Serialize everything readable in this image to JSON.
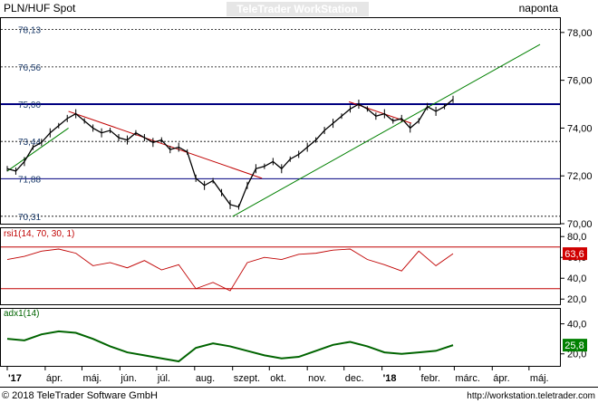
{
  "header": {
    "symbol": "PLN/HUF Spot",
    "watermark": "TeleTrader WorkStation",
    "interval": "naponta"
  },
  "footer": {
    "copyright": "© 2018 TeleTrader Software GmbH",
    "url": "http://workstation.teletrader.com"
  },
  "colors": {
    "price": "#000000",
    "trend_up": "#008000",
    "trend_down": "#c00000",
    "level_line": "#000080",
    "rsi": "#c00000",
    "rsi_badge": "#d00000",
    "adx": "#006400",
    "adx_badge": "#008000",
    "border": "#000000",
    "dashed": "#000000"
  },
  "chart_data": [
    {
      "type": "line",
      "panel": "price",
      "title": "PLN/HUF Spot",
      "x_ticks": [
        "'17",
        "ápr.",
        "máj.",
        "jún.",
        "júl.",
        "aug.",
        "szept.",
        "okt.",
        "nov.",
        "dec.",
        "'18",
        "febr.",
        "márc.",
        "ápr.",
        "máj."
      ],
      "ylim": [
        70.0,
        78.6
      ],
      "y_ticks": [
        "70,00",
        "72,00",
        "74,00",
        "76,00",
        "78,00"
      ],
      "series": [
        {
          "x": [
            "2017-03-01",
            "2017-03-08",
            "2017-03-15",
            "2017-03-22",
            "2017-03-29",
            "2017-04-05",
            "2017-04-12",
            "2017-04-19",
            "2017-04-26",
            "2017-05-03",
            "2017-05-10",
            "2017-05-17",
            "2017-05-24",
            "2017-05-31",
            "2017-06-07",
            "2017-06-14",
            "2017-06-21",
            "2017-06-28",
            "2017-07-05",
            "2017-07-12",
            "2017-07-19",
            "2017-07-26",
            "2017-08-02",
            "2017-08-09",
            "2017-08-16",
            "2017-08-23",
            "2017-08-30",
            "2017-09-06",
            "2017-09-13",
            "2017-09-20",
            "2017-09-27",
            "2017-10-04",
            "2017-10-11",
            "2017-10-18",
            "2017-10-25",
            "2017-11-01",
            "2017-11-08",
            "2017-11-15",
            "2017-11-22",
            "2017-11-29",
            "2017-12-06",
            "2017-12-13",
            "2017-12-20",
            "2017-12-27",
            "2018-01-03",
            "2018-01-10",
            "2018-01-17",
            "2018-01-24",
            "2018-01-31",
            "2018-02-07",
            "2018-02-14",
            "2018-02-21",
            "2018-02-28"
          ],
          "values": [
            72.3,
            72.2,
            72.6,
            73.2,
            73.4,
            73.8,
            74.1,
            74.4,
            74.6,
            74.3,
            74.0,
            73.8,
            73.9,
            73.6,
            73.5,
            73.8,
            73.6,
            73.4,
            73.5,
            73.1,
            73.2,
            73.0,
            71.9,
            71.6,
            71.8,
            71.3,
            70.8,
            70.7,
            71.6,
            72.3,
            72.4,
            72.6,
            72.3,
            72.7,
            72.9,
            73.2,
            73.5,
            73.9,
            74.2,
            74.5,
            74.8,
            75.0,
            74.8,
            74.5,
            74.6,
            74.3,
            74.4,
            74.0,
            74.3,
            74.9,
            74.7,
            74.9,
            75.2
          ]
        }
      ],
      "reference_lines": [
        {
          "value": 78.13,
          "label": "78,13",
          "style": "dashed"
        },
        {
          "value": 76.56,
          "label": "76,56",
          "style": "dashed"
        },
        {
          "value": 75.0,
          "label": "75,00",
          "style": "solid-thick"
        },
        {
          "value": 73.44,
          "label": "73,44",
          "style": "dashed"
        },
        {
          "value": 71.88,
          "label": "71,88",
          "style": "solid"
        },
        {
          "value": 70.31,
          "label": "70,31",
          "style": "dashed"
        }
      ],
      "trendlines": [
        {
          "kind": "up",
          "from": [
            "2017-03-01",
            72.2
          ],
          "to": [
            "2017-04-20",
            74.0
          ]
        },
        {
          "kind": "down",
          "from": [
            "2017-04-20",
            74.7
          ],
          "to": [
            "2017-09-25",
            71.9
          ]
        },
        {
          "kind": "up",
          "from": [
            "2017-09-01",
            70.3
          ],
          "to": [
            "2018-05-10",
            77.5
          ]
        },
        {
          "kind": "down",
          "from": [
            "2017-12-05",
            75.1
          ],
          "to": [
            "2018-01-25",
            74.2
          ]
        }
      ]
    },
    {
      "type": "line",
      "panel": "rsi",
      "title": "rsi1(14, 70, 30, 1)",
      "ylim": [
        15,
        88
      ],
      "y_ticks": [
        "20,0",
        "40,0",
        "60,0",
        "80,0"
      ],
      "levels": [
        70,
        30
      ],
      "last_value": "63,6",
      "series": [
        {
          "x": [
            "2017-03-01",
            "2017-03-15",
            "2017-03-29",
            "2017-04-12",
            "2017-04-26",
            "2017-05-10",
            "2017-05-24",
            "2017-06-07",
            "2017-06-21",
            "2017-07-05",
            "2017-07-19",
            "2017-08-02",
            "2017-08-16",
            "2017-08-30",
            "2017-09-13",
            "2017-09-27",
            "2017-10-11",
            "2017-10-25",
            "2017-11-08",
            "2017-11-22",
            "2017-12-06",
            "2017-12-20",
            "2018-01-03",
            "2018-01-17",
            "2018-01-31",
            "2018-02-14",
            "2018-02-28"
          ],
          "values": [
            58,
            61,
            66,
            68,
            64,
            52,
            55,
            50,
            57,
            48,
            53,
            30,
            36,
            28,
            55,
            60,
            58,
            63,
            64,
            67,
            68,
            58,
            53,
            47,
            66,
            52,
            63.6
          ]
        }
      ]
    },
    {
      "type": "line",
      "panel": "adx",
      "title": "adx1(14)",
      "ylim": [
        12,
        50
      ],
      "y_ticks": [
        "20,0",
        "40,0"
      ],
      "last_value": "25,8",
      "series": [
        {
          "x": [
            "2017-03-01",
            "2017-03-15",
            "2017-03-29",
            "2017-04-12",
            "2017-04-26",
            "2017-05-10",
            "2017-05-24",
            "2017-06-07",
            "2017-06-21",
            "2017-07-05",
            "2017-07-19",
            "2017-08-02",
            "2017-08-16",
            "2017-08-30",
            "2017-09-13",
            "2017-09-27",
            "2017-10-11",
            "2017-10-25",
            "2017-11-08",
            "2017-11-22",
            "2017-12-06",
            "2017-12-20",
            "2018-01-03",
            "2018-01-17",
            "2018-01-31",
            "2018-02-14",
            "2018-02-28"
          ],
          "values": [
            30,
            29,
            33,
            35,
            34,
            30,
            25,
            21,
            19,
            17,
            15,
            24,
            27,
            25,
            22,
            19,
            17,
            18,
            22,
            26,
            28,
            25,
            21,
            20,
            21,
            22,
            25.8
          ]
        }
      ]
    }
  ]
}
